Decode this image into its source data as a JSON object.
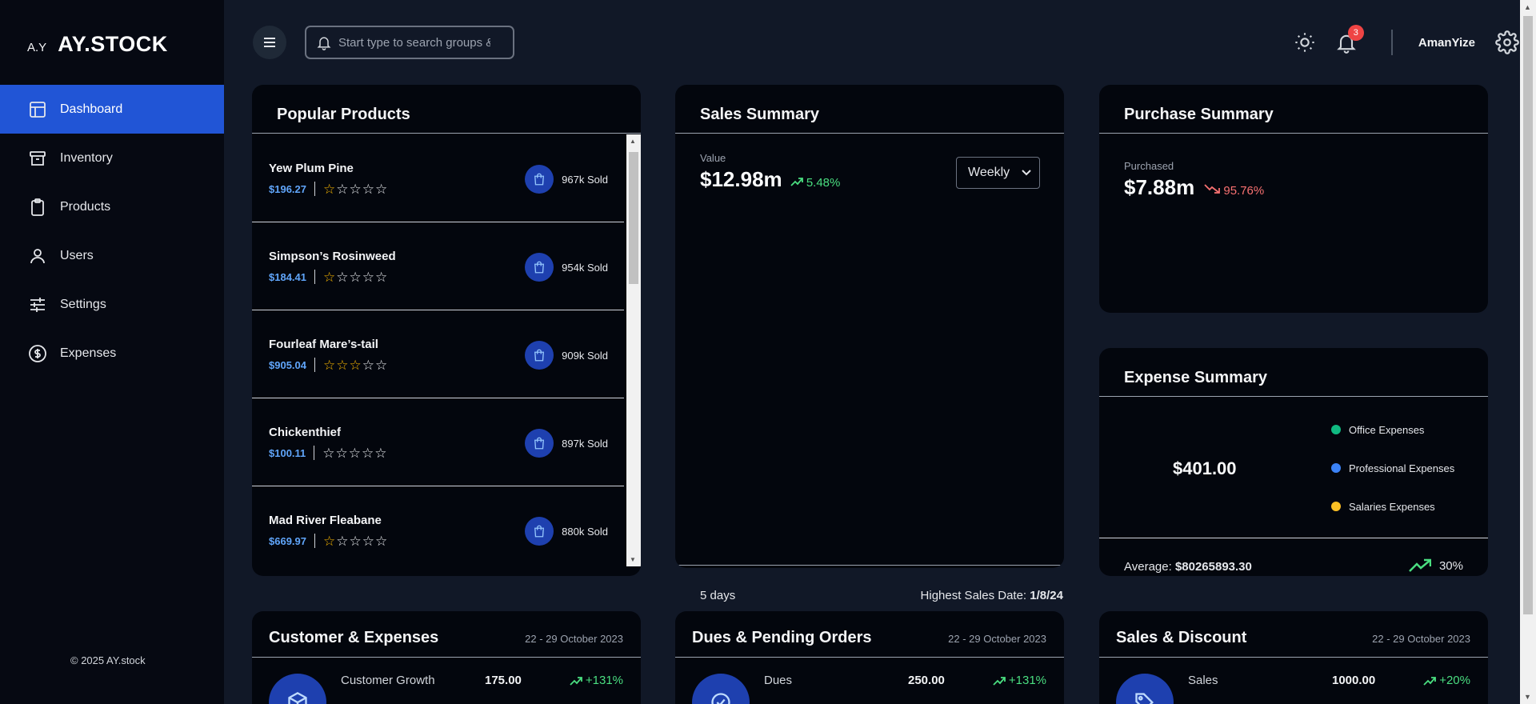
{
  "sidebar": {
    "logo_mark": "A.Y",
    "logo_text": "AY.STOCK",
    "items": [
      {
        "label": "Dashboard",
        "icon": "layout-icon",
        "active": true
      },
      {
        "label": "Inventory",
        "icon": "archive-icon"
      },
      {
        "label": "Products",
        "icon": "clipboard-icon"
      },
      {
        "label": "Users",
        "icon": "user-icon"
      },
      {
        "label": "Settings",
        "icon": "sliders-icon"
      },
      {
        "label": "Expenses",
        "icon": "dollar-circle-icon"
      }
    ],
    "footer": "© 2025 AY.stock"
  },
  "topbar": {
    "search_placeholder": "Start type to search groups & products",
    "notification_count": "3",
    "username": "AmanYize"
  },
  "popular_products": {
    "title": "Popular Products",
    "items": [
      {
        "name": "Yew Plum Pine",
        "price": "$196.27",
        "rating": 1,
        "sold": "967k Sold"
      },
      {
        "name": "Simpson’s Rosinweed",
        "price": "$184.41",
        "rating": 1,
        "sold": "954k Sold"
      },
      {
        "name": "Fourleaf Mare’s-tail",
        "price": "$905.04",
        "rating": 3,
        "sold": "909k Sold"
      },
      {
        "name": "Chickenthief",
        "price": "$100.11",
        "rating": 0,
        "sold": "897k Sold"
      },
      {
        "name": "Mad River Fleabane",
        "price": "$669.97",
        "rating": 1,
        "sold": "880k Sold"
      }
    ]
  },
  "sales_summary": {
    "title": "Sales Summary",
    "value_label": "Value",
    "value": "$12.98m",
    "change": "5.48%",
    "period": "Weekly",
    "days": "5 days",
    "highest_label": "Highest Sales Date:",
    "highest_date": "1/8/24"
  },
  "purchase_summary": {
    "title": "Purchase Summary",
    "label": "Purchased",
    "value": "$7.88m",
    "change": "95.76%"
  },
  "expense_summary": {
    "title": "Expense Summary",
    "total": "$401.00",
    "legend": [
      {
        "label": "Office Expenses",
        "color": "#10b981"
      },
      {
        "label": "Professional Expenses",
        "color": "#3b82f6"
      },
      {
        "label": "Salaries Expenses",
        "color": "#fbbf24"
      }
    ],
    "average_label": "Average:",
    "average_value": "$80265893.30",
    "change": "30%"
  },
  "bottom_cards": [
    {
      "title": "Customer & Expenses",
      "date": "22 - 29 October 2023",
      "label": "Customer Growth",
      "value": "175.00",
      "change": "+131%",
      "icon": "box-icon"
    },
    {
      "title": "Dues & Pending Orders",
      "date": "22 - 29 October 2023",
      "label": "Dues",
      "value": "250.00",
      "change": "+131%",
      "icon": "check-circle-icon"
    },
    {
      "title": "Sales & Discount",
      "date": "22 - 29 October 2023",
      "label": "Sales",
      "value": "1000.00",
      "change": "+20%",
      "icon": "tag-icon"
    }
  ]
}
